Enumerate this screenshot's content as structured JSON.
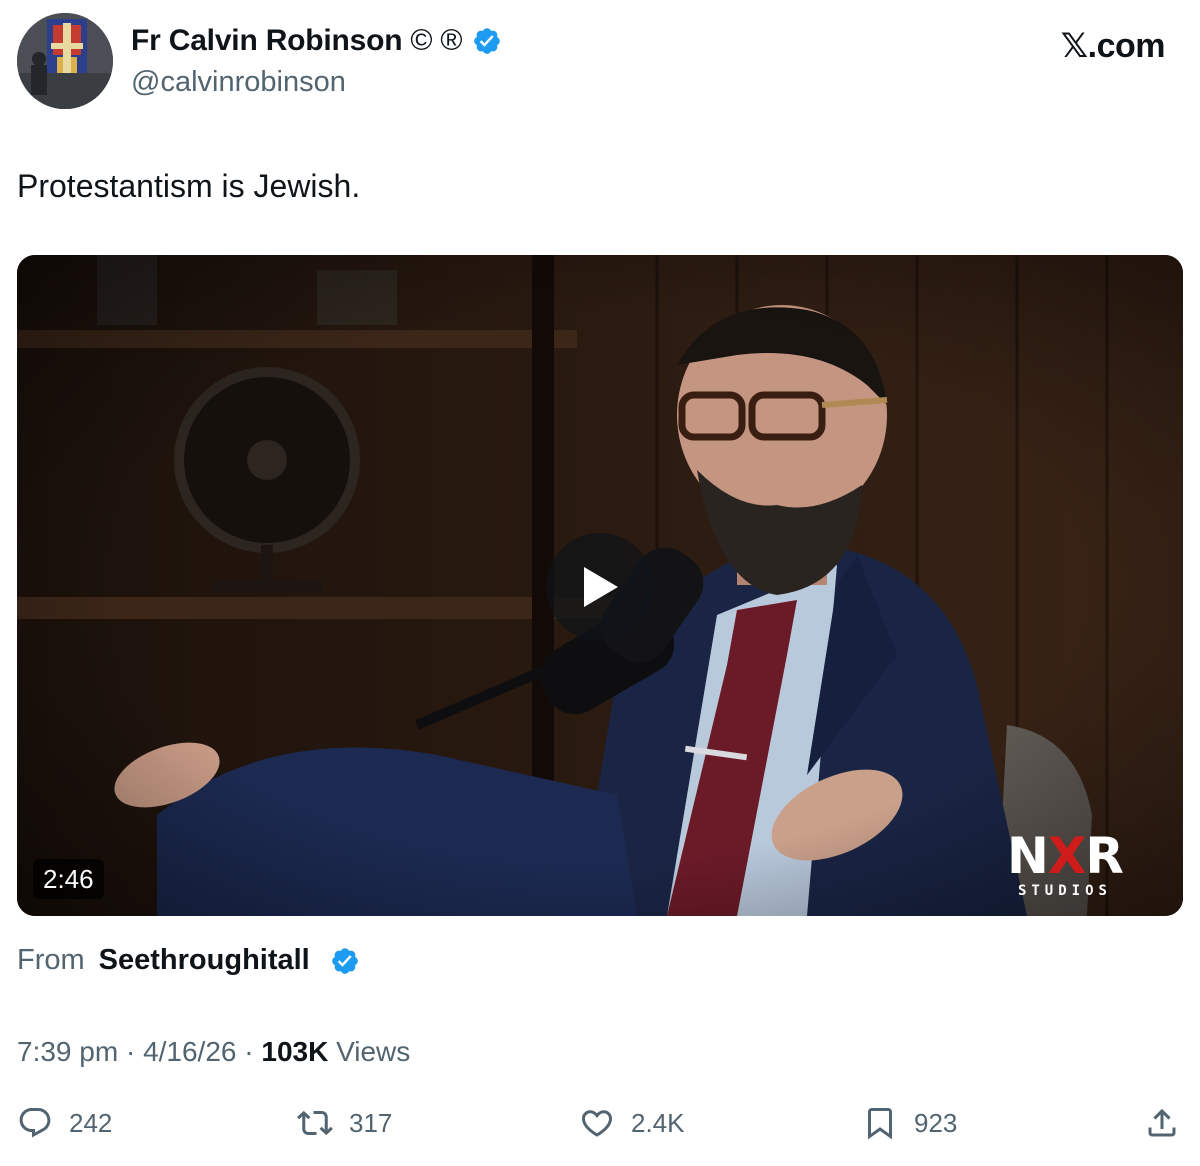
{
  "author": {
    "display_name": "Fr Calvin Robinson",
    "badge_copyright": "©",
    "badge_registered": "®",
    "verified_icon": "verified-badge-icon",
    "handle": "@calvinrobinson"
  },
  "site": {
    "logo_text": "𝕏.com"
  },
  "tweet": {
    "text": "Protestantism is Jewish."
  },
  "media": {
    "duration": "2:46",
    "watermark_mark_left": "N",
    "watermark_mark_x": "X",
    "watermark_mark_right": "R",
    "watermark_sub": "STUDIOS",
    "play_icon": "play-icon"
  },
  "attribution": {
    "prefix": "From",
    "source": "Seethroughitall"
  },
  "meta": {
    "time": "7:39 pm",
    "separator": "·",
    "date": "4/16/26",
    "views_count": "103K",
    "views_label": "Views"
  },
  "actions": {
    "reply_count": "242",
    "repost_count": "317",
    "like_count": "2.4K",
    "bookmark_count": "923"
  },
  "colors": {
    "text": "#0f1419",
    "secondary_text": "#536471",
    "verified_blue": "#1d9bf0",
    "watermark_red": "#d01b1b"
  }
}
